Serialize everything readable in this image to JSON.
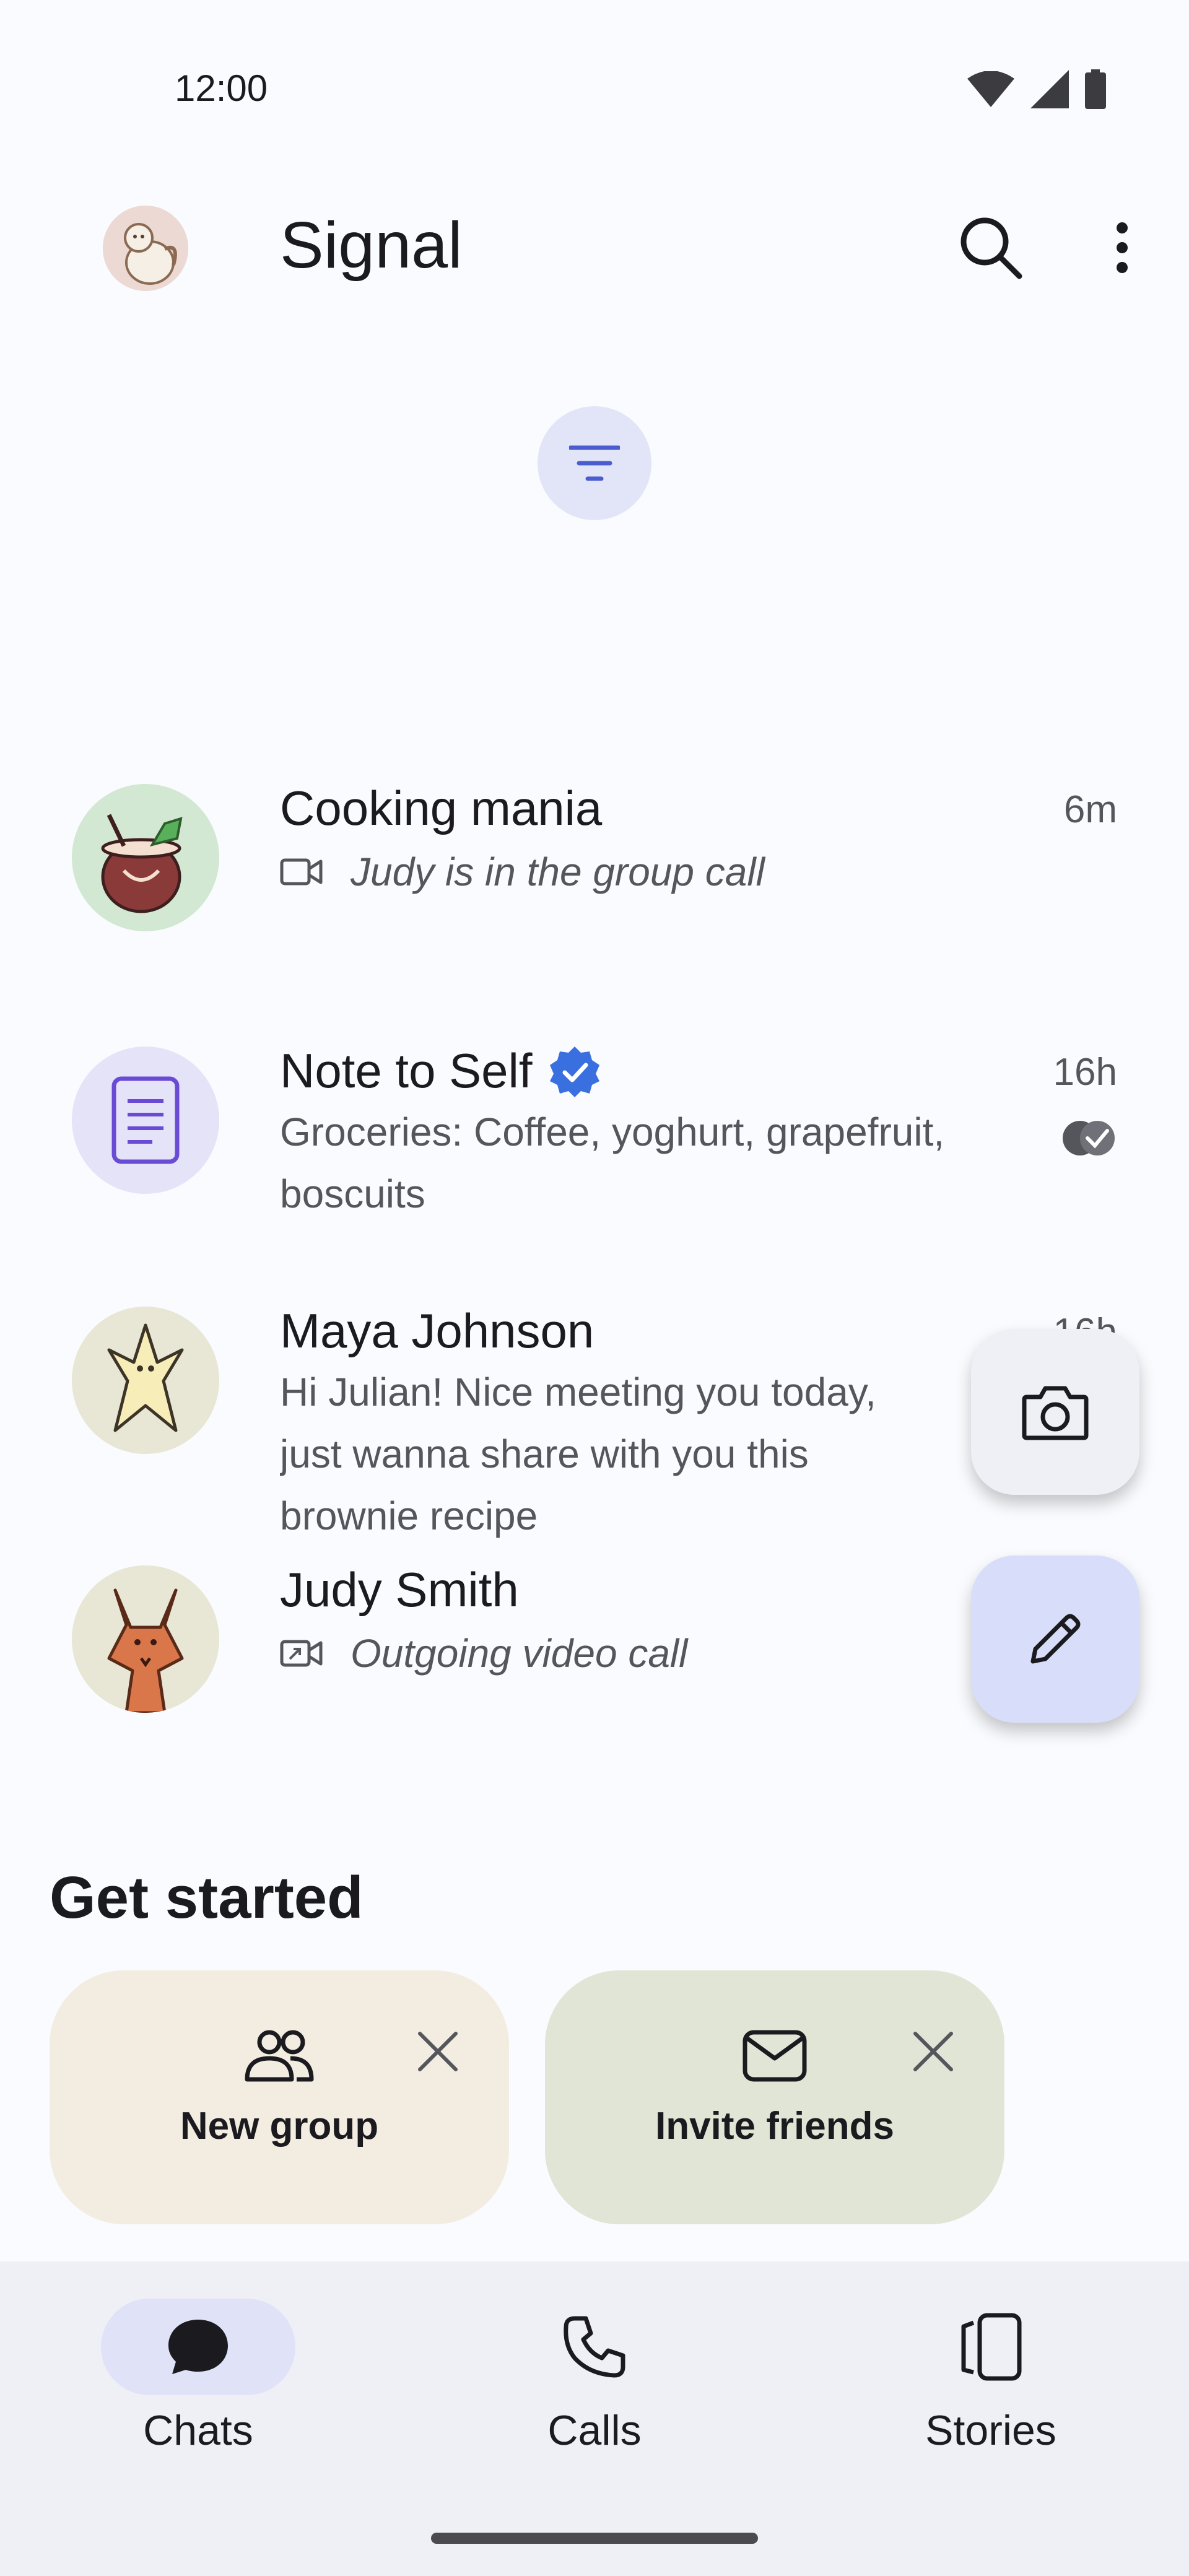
{
  "status_bar": {
    "time": "12:00",
    "icons": [
      "wifi-icon",
      "cellular-signal-icon",
      "battery-icon"
    ]
  },
  "header": {
    "title": "Signal",
    "avatar_icon": "user-avatar",
    "search_icon": "search-icon",
    "more_icon": "more-vert-icon"
  },
  "filter": {
    "icon": "filter-icon"
  },
  "chats": [
    {
      "name": "Cooking mania",
      "snippet": "Judy is in the group call",
      "time": "6m",
      "snippet_icon": "video-camera-icon",
      "avatar": "coconut-drink-avatar"
    },
    {
      "name": "Note to Self",
      "snippet": "Groceries: Coffee, yoghurt, grapefruit, boscuits",
      "time": "16h",
      "verified": true,
      "status_icon": "read-receipt-icon",
      "avatar": "note-avatar"
    },
    {
      "name": "Maya Johnson",
      "snippet": "Hi Julian! Nice meeting you today, just wanna share with you this brownie recipe",
      "time": "16h",
      "avatar": "creature-avatar"
    },
    {
      "name": "Judy Smith",
      "snippet": "Outgoing video call",
      "time": "",
      "snippet_icon": "outgoing-video-icon",
      "avatar": "fox-avatar"
    }
  ],
  "fab": {
    "camera_icon": "camera-icon",
    "compose_icon": "pencil-icon"
  },
  "get_started": {
    "title": "Get started",
    "cards": [
      {
        "label": "New group",
        "icon": "group-icon",
        "bg": "#f3ede1"
      },
      {
        "label": "Invite friends",
        "icon": "mail-icon",
        "bg": "#e0e5d6"
      }
    ]
  },
  "bottom_nav": {
    "items": [
      {
        "label": "Chats",
        "icon": "chat-bubble-icon",
        "active": true
      },
      {
        "label": "Calls",
        "icon": "phone-icon",
        "active": false
      },
      {
        "label": "Stories",
        "icon": "stories-icon",
        "active": false
      }
    ]
  },
  "colors": {
    "background": "#fafbfe",
    "accent": "#3a76f0",
    "active_pill": "#e0e3f7",
    "fab_compose": "#d8def9"
  }
}
